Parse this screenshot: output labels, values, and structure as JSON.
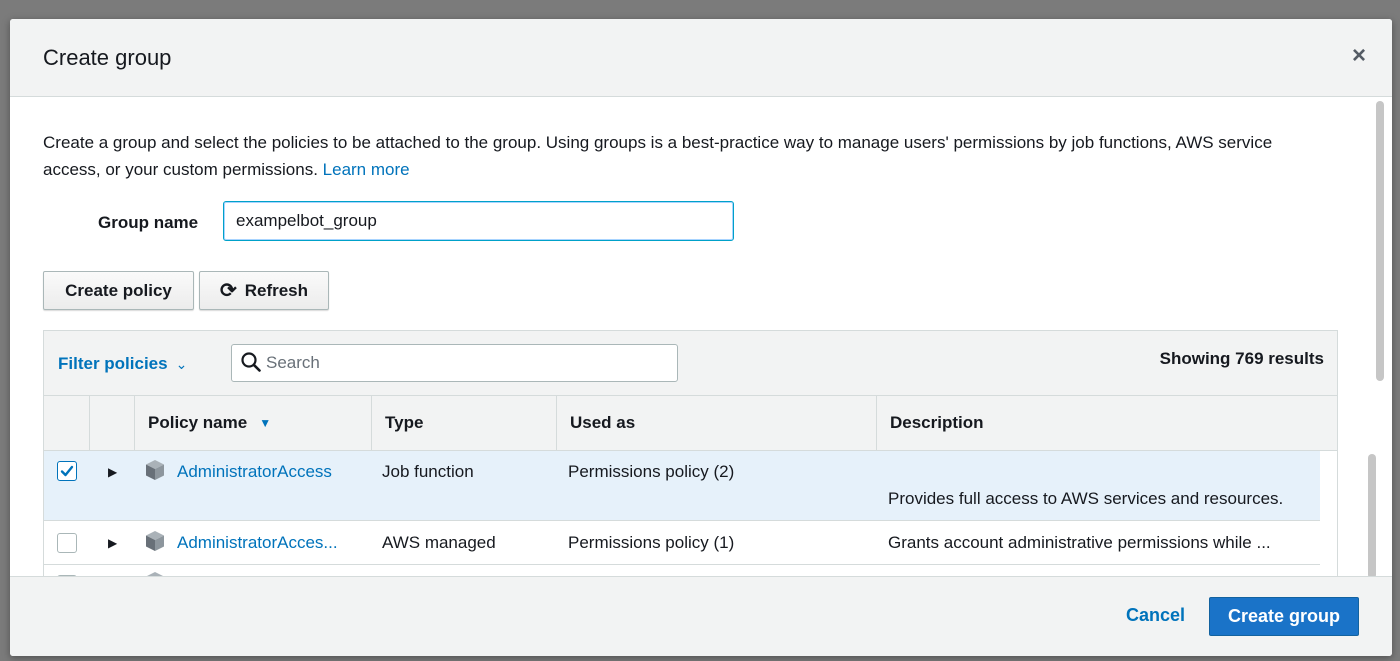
{
  "dialog": {
    "title": "Create group",
    "close_symbol": "×",
    "intro_text": "Create a group and select the policies to be attached to the group. Using groups is a best-practice way to manage users' permissions by job functions, AWS service access, or your custom permissions.",
    "learn_more": "Learn more"
  },
  "form": {
    "group_name_label": "Group name",
    "group_name_value": "exampelbot_group"
  },
  "toolbar": {
    "create_policy_label": "Create policy",
    "refresh_label": "Refresh",
    "refresh_icon": "⟳"
  },
  "filter": {
    "filter_label": "Filter policies",
    "chevron": "⌄",
    "search_placeholder": "Search",
    "results_text": "Showing 769 results"
  },
  "table": {
    "columns": {
      "policy_name": "Policy name",
      "sort_caret": "▼",
      "type": "Type",
      "used_as": "Used as",
      "description": "Description"
    },
    "rows": [
      {
        "checked": true,
        "name": "AdministratorAccess",
        "type": "Job function",
        "used_as": "Permissions policy (2)",
        "description": "Provides full access to AWS services and resources."
      },
      {
        "checked": false,
        "name": "AdministratorAcces...",
        "type": "AWS managed",
        "used_as": "Permissions policy (1)",
        "description": "Grants account administrative permissions while ..."
      }
    ]
  },
  "footer": {
    "cancel_label": "Cancel",
    "create_group_label": "Create group"
  },
  "colors": {
    "link": "#0073bb",
    "primary_button": "#1a73c8",
    "selected_row": "#e6f1fa",
    "header_bg": "#f2f3f3"
  },
  "icons": {
    "close": "close-icon",
    "refresh": "refresh-icon",
    "search": "search-icon",
    "expand": "caret-right-icon",
    "policy": "box-icon",
    "checkbox": "checkmark-icon"
  }
}
